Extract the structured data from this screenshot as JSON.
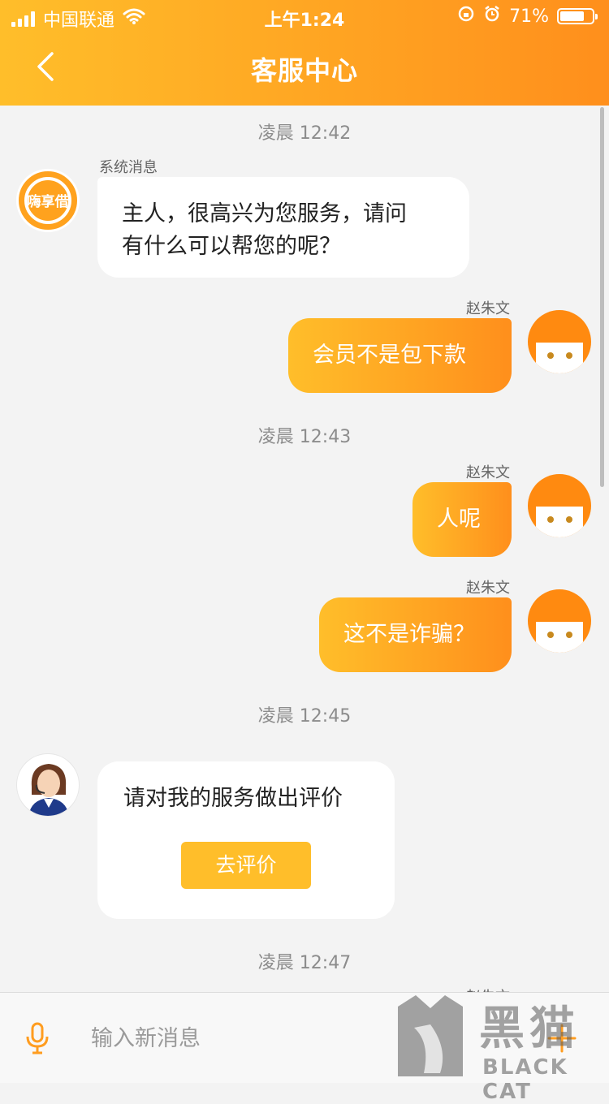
{
  "status_bar": {
    "carrier": "中国联通",
    "time": "上午1:24",
    "battery": "71%"
  },
  "header": {
    "title": "客服中心"
  },
  "messages": {
    "t1": "凌晨 12:42",
    "sys_sender": "系统消息",
    "sys_text_1": "主人，很高兴为您服务，请问",
    "sys_text_2": "有什么可以帮您的呢？",
    "user_name": "赵朱文",
    "m1": "会员不是包下款",
    "t2": "凌晨 12:43",
    "m2": "人呢",
    "m3": "这不是诈骗？",
    "t3": "凌晨 12:45",
    "rate_prompt": "请对我的服务做出评价",
    "rate_button": "去评价",
    "t4": "凌晨 12:47",
    "partial_sender": "赵朱文"
  },
  "app_logo_text": "嗨享借",
  "input": {
    "placeholder": "输入新消息"
  },
  "watermark": {
    "big": "黑猫",
    "small": "BLACK CAT"
  },
  "colors": {
    "accent_start": "#ffbe2a",
    "accent_end": "#ff8f1c",
    "background": "#f3f3f3"
  }
}
